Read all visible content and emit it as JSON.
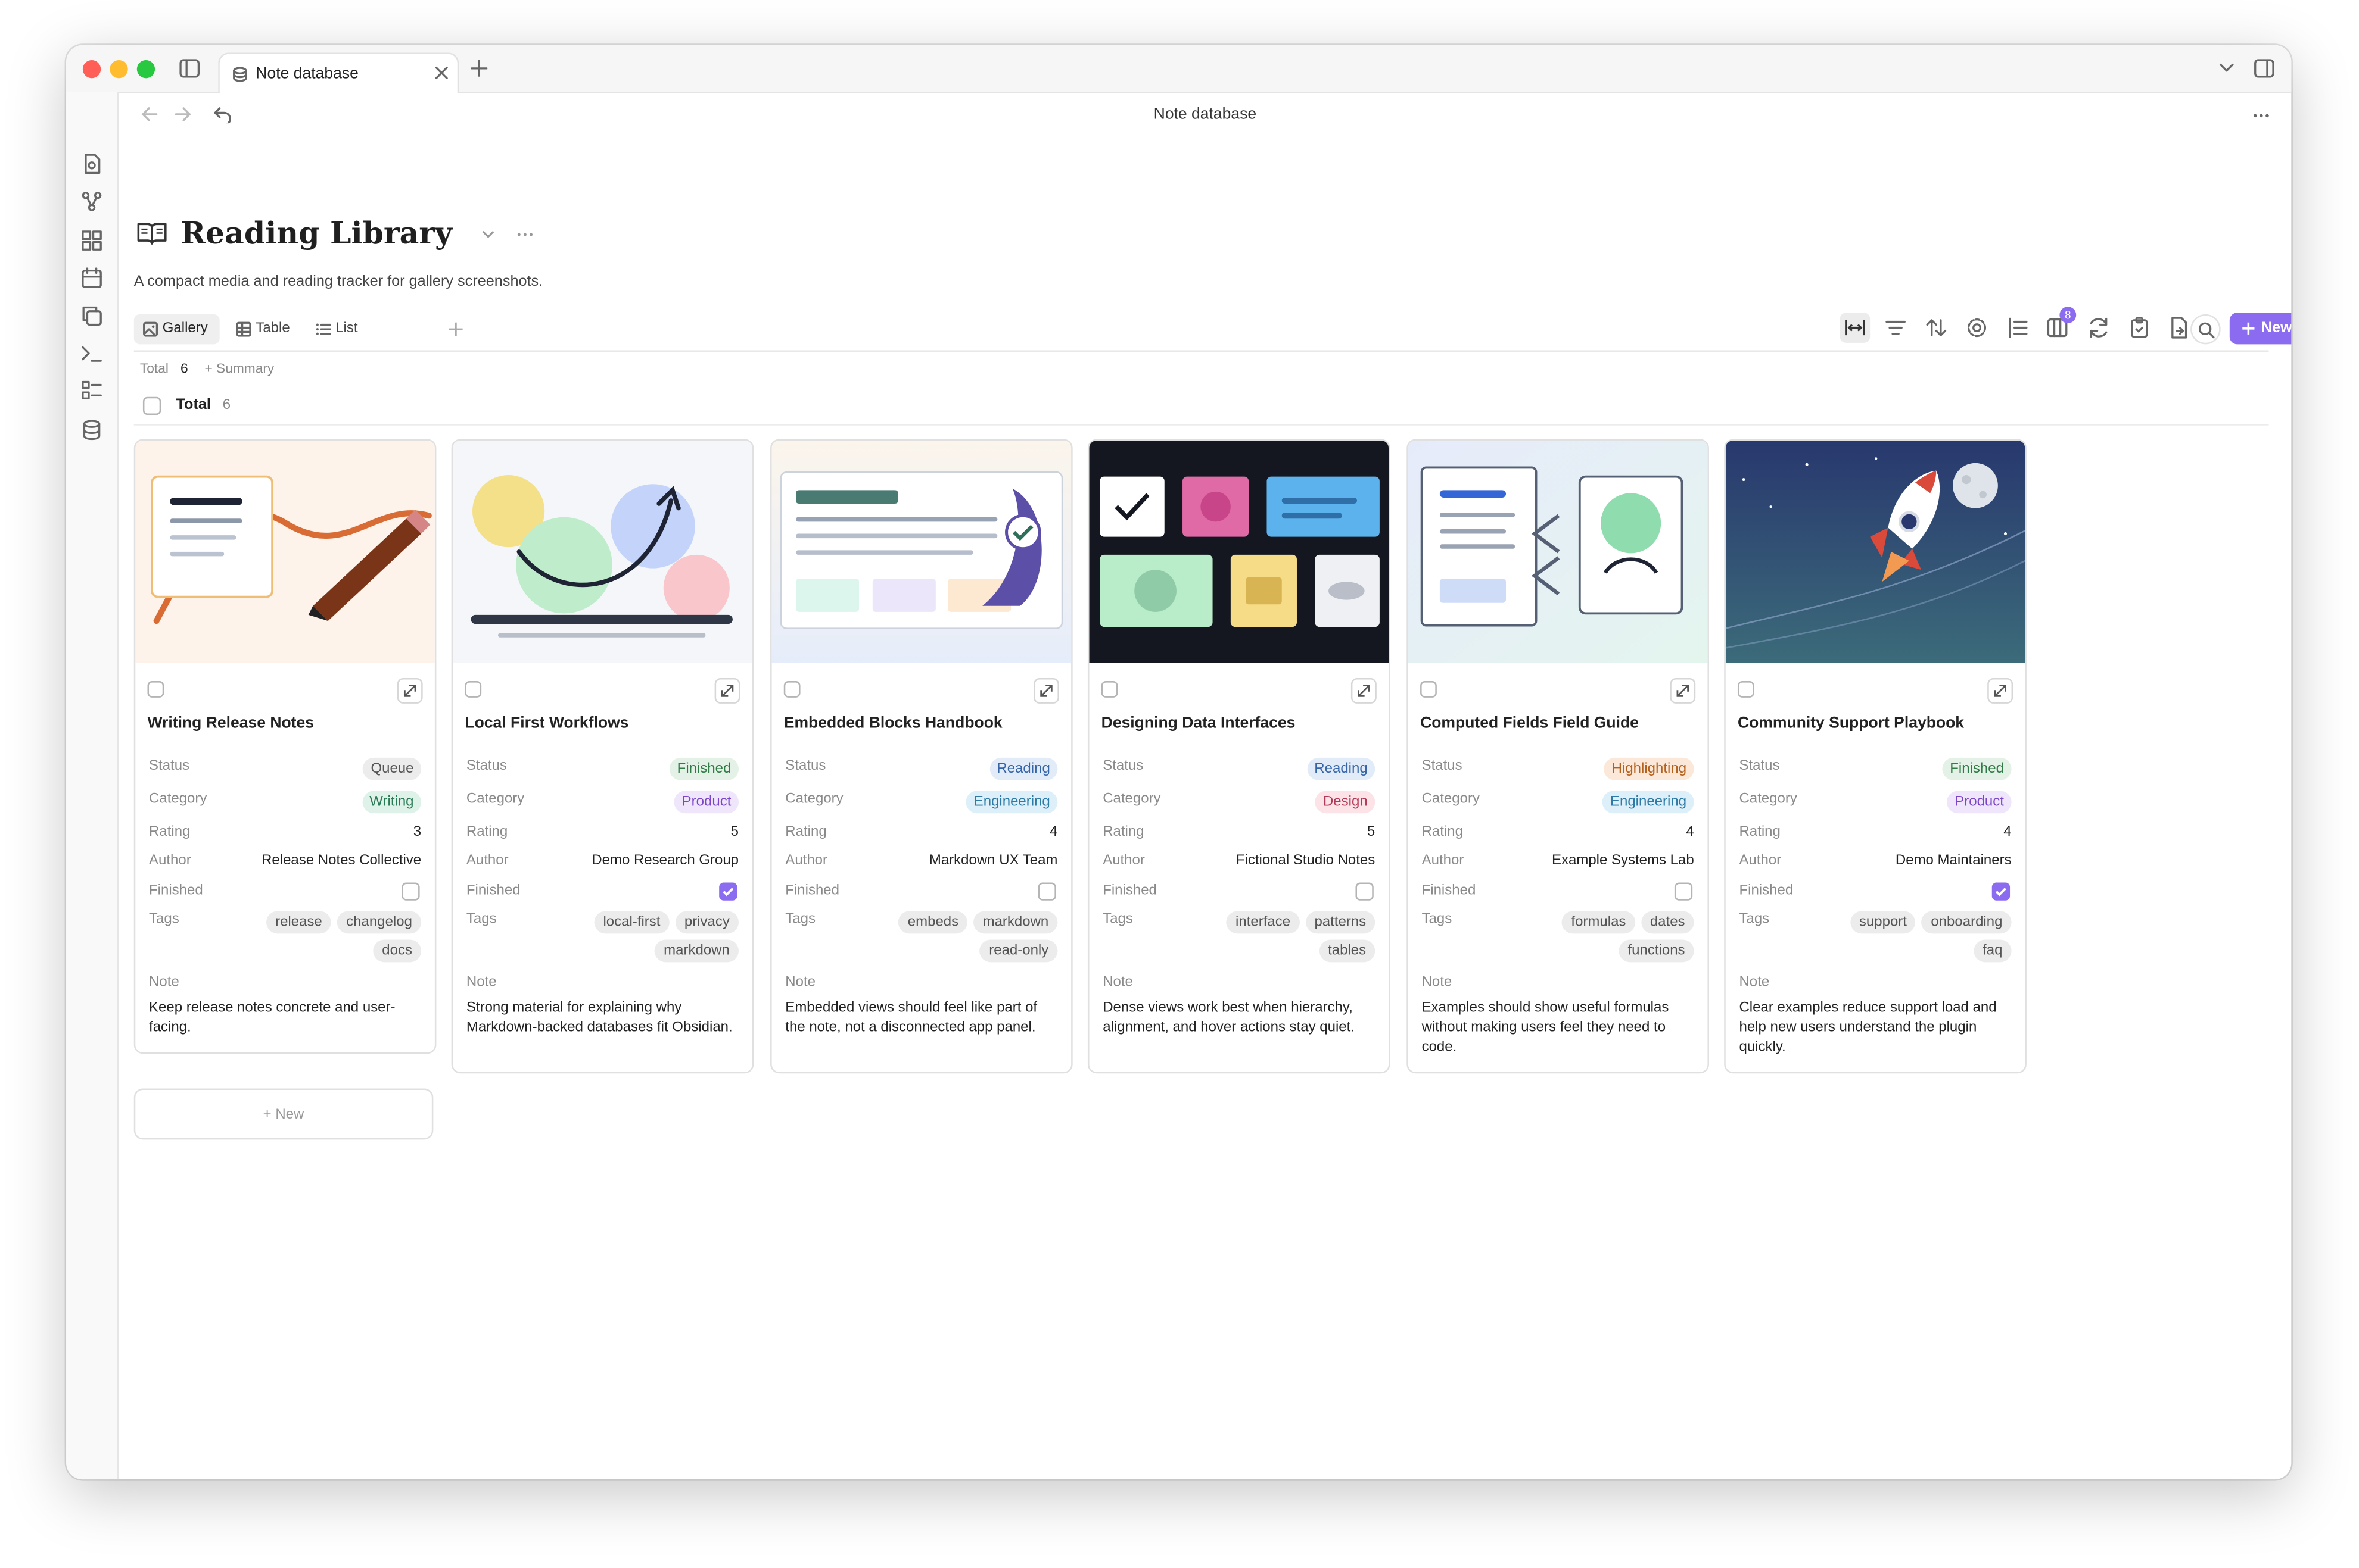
{
  "window": {
    "tab_title": "Note database",
    "header_title": "Note database"
  },
  "page": {
    "title": "Reading Library",
    "description": "A compact media and reading tracker for gallery screenshots.",
    "views": [
      {
        "label": "Gallery",
        "icon": "image-icon",
        "active": true
      },
      {
        "label": "Table",
        "icon": "table-icon",
        "active": false
      },
      {
        "label": "List",
        "icon": "list-icon",
        "active": false
      }
    ],
    "toolbar_badge": "8",
    "new_button": "New",
    "summary": {
      "total_label": "Total",
      "total_value": "6",
      "add_summary": "+ Summary"
    },
    "group": {
      "label": "Total",
      "count": "6"
    },
    "add_card": "+ New"
  },
  "labels": {
    "status": "Status",
    "category": "Category",
    "rating": "Rating",
    "author": "Author",
    "finished": "Finished",
    "tags": "Tags",
    "note": "Note"
  },
  "cards": [
    {
      "title": "Writing Release Notes",
      "status": "Queue",
      "category": "Writing",
      "rating": "3",
      "author": "Release Notes Collective",
      "finished": false,
      "tags": [
        [
          "release",
          "changelog"
        ],
        [
          "docs"
        ]
      ],
      "note": "Keep release notes concrete and user-facing."
    },
    {
      "title": "Local First Workflows",
      "status": "Finished",
      "category": "Product",
      "rating": "5",
      "author": "Demo Research Group",
      "finished": true,
      "tags": [
        [
          "local-first",
          "privacy"
        ],
        [
          "markdown"
        ]
      ],
      "note": "Strong material for explaining why Markdown-backed databases fit Obsidian."
    },
    {
      "title": "Embedded Blocks Handbook",
      "status": "Reading",
      "category": "Engineering",
      "rating": "4",
      "author": "Markdown UX Team",
      "finished": false,
      "tags": [
        [
          "embeds",
          "markdown"
        ],
        [
          "read-only"
        ]
      ],
      "note": "Embedded views should feel like part of the note, not a disconnected app panel."
    },
    {
      "title": "Designing Data Interfaces",
      "status": "Reading",
      "category": "Design",
      "rating": "5",
      "author": "Fictional Studio Notes",
      "finished": false,
      "tags": [
        [
          "interface",
          "patterns"
        ],
        [
          "tables"
        ]
      ],
      "note": "Dense views work best when hierarchy, alignment, and hover actions stay quiet."
    },
    {
      "title": "Computed Fields Field Guide",
      "status": "Highlighting",
      "category": "Engineering",
      "rating": "4",
      "author": "Example Systems Lab",
      "finished": false,
      "tags": [
        [
          "formulas",
          "dates"
        ],
        [
          "functions"
        ]
      ],
      "note": "Examples should show useful formulas without making users feel they need to code."
    },
    {
      "title": "Community Support Playbook",
      "status": "Finished",
      "category": "Product",
      "rating": "4",
      "author": "Demo Maintainers",
      "finished": true,
      "tags": [
        [
          "support",
          "onboarding"
        ],
        [
          "faq"
        ]
      ],
      "note": "Clear examples reduce support load and help new users understand the plugin quickly."
    }
  ],
  "colors": {
    "accent": "#8b6cf0",
    "status": {
      "Queue": [
        "#ececec",
        "#555555"
      ],
      "Finished": [
        "#e3f1e6",
        "#2f7a45"
      ],
      "Reading": [
        "#e2ecf8",
        "#3565a8"
      ],
      "Highlighting": [
        "#fbe8d8",
        "#b5611d"
      ]
    },
    "category": {
      "Writing": [
        "#dff2ea",
        "#2a7a55"
      ],
      "Product": [
        "#efe6fb",
        "#7a46c7"
      ],
      "Engineering": [
        "#ddeff8",
        "#2c7aa5"
      ],
      "Design": [
        "#fbe3e8",
        "#b33a56"
      ]
    }
  }
}
